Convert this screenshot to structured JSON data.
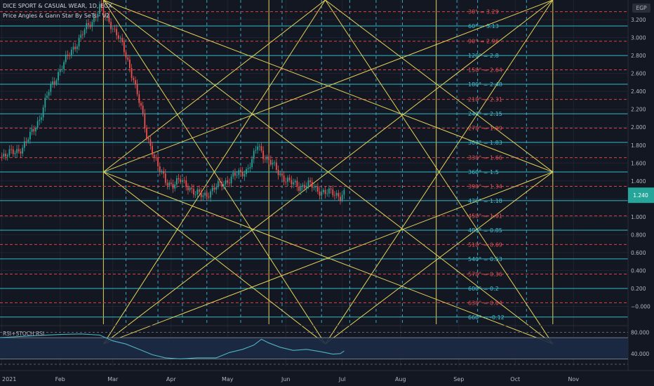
{
  "header": {
    "symbol": "DICE SPORT & CASUAL WEAR, 1D, EGX",
    "indicator": "Price Angles & Gann Star By SeTs - V2",
    "currency": "EGP"
  },
  "colors": {
    "background": "#131722",
    "up_candle": "#26a69a",
    "down_candle": "#ef5350",
    "gann_star": "#e6d15a",
    "price_level_cyan": "#33b8c8",
    "price_level_red": "#d84343",
    "time_line": "#3aa3c9",
    "last_price": "#26a69a",
    "rsi_line": "#4eb3c2"
  },
  "chart_data": [
    {
      "type": "candlestick",
      "title": "DICE SPORT & CASUAL WEAR, 1D, EGX",
      "y_axis": {
        "unit": "EGP",
        "range": [
          -0.2,
          3.42
        ],
        "ticks": [
          "3.200",
          "3.000",
          "2.800",
          "2.600",
          "2.400",
          "2.200",
          "2.000",
          "1.800",
          "1.600",
          "1.400",
          "1.200",
          "1.000",
          "0.800",
          "0.600",
          "0.400",
          "0.200",
          "−0.000"
        ]
      },
      "x_axis": {
        "range": [
          "2020-12-31",
          "2021-11-30"
        ],
        "tick_labels": [
          {
            "label": "2021",
            "date": "2021-01-01"
          },
          {
            "label": "Feb",
            "date": "2021-02-01"
          },
          {
            "label": "Mar",
            "date": "2021-03-01"
          },
          {
            "label": "Apr",
            "date": "2021-04-01"
          },
          {
            "label": "May",
            "date": "2021-05-01"
          },
          {
            "label": "Jun",
            "date": "2021-06-01"
          },
          {
            "label": "Jul",
            "date": "2021-07-01"
          },
          {
            "label": "Aug",
            "date": "2021-08-01"
          },
          {
            "label": "Sep",
            "date": "2021-09-01"
          },
          {
            "label": "Oct",
            "date": "2021-10-01"
          },
          {
            "label": "Nov",
            "date": "2021-11-01"
          }
        ]
      },
      "last_price": 1.24,
      "price_path": [
        [
          "2020-12-31",
          1.68
        ],
        [
          "2021-01-08",
          1.72
        ],
        [
          "2021-01-12",
          1.78
        ],
        [
          "2021-01-16",
          1.9
        ],
        [
          "2021-01-21",
          2.1
        ],
        [
          "2021-01-26",
          2.4
        ],
        [
          "2021-02-01",
          2.65
        ],
        [
          "2021-02-07",
          2.85
        ],
        [
          "2021-02-13",
          3.05
        ],
        [
          "2021-02-18",
          3.18
        ],
        [
          "2021-02-22",
          3.35
        ],
        [
          "2021-02-25",
          3.22
        ],
        [
          "2021-03-01",
          3.12
        ],
        [
          "2021-03-04",
          3.02
        ],
        [
          "2021-03-08",
          2.78
        ],
        [
          "2021-03-12",
          2.55
        ],
        [
          "2021-03-16",
          2.2
        ],
        [
          "2021-03-19",
          1.9
        ],
        [
          "2021-03-22",
          1.75
        ],
        [
          "2021-03-25",
          1.55
        ],
        [
          "2021-03-29",
          1.4
        ],
        [
          "2021-04-02",
          1.36
        ],
        [
          "2021-04-06",
          1.4
        ],
        [
          "2021-04-10",
          1.35
        ],
        [
          "2021-04-14",
          1.25
        ],
        [
          "2021-04-18",
          1.24
        ],
        [
          "2021-04-22",
          1.28
        ],
        [
          "2021-04-27",
          1.36
        ],
        [
          "2021-05-02",
          1.42
        ],
        [
          "2021-05-07",
          1.48
        ],
        [
          "2021-05-11",
          1.52
        ],
        [
          "2021-05-14",
          1.62
        ],
        [
          "2021-05-17",
          1.8
        ],
        [
          "2021-05-20",
          1.7
        ],
        [
          "2021-05-24",
          1.6
        ],
        [
          "2021-05-28",
          1.5
        ],
        [
          "2021-06-03",
          1.38
        ],
        [
          "2021-06-08",
          1.34
        ],
        [
          "2021-06-13",
          1.36
        ],
        [
          "2021-06-17",
          1.31
        ],
        [
          "2021-06-22",
          1.27
        ],
        [
          "2021-06-26",
          1.26
        ],
        [
          "2021-06-30",
          1.24
        ],
        [
          "2021-07-02",
          1.26
        ]
      ],
      "price_levels": [
        {
          "label": "30° = 3.29",
          "value": 3.29,
          "color": "red"
        },
        {
          "label": "60° = 3.13",
          "value": 3.13,
          "color": "cyan"
        },
        {
          "label": "90° = 2.96",
          "value": 2.96,
          "color": "red"
        },
        {
          "label": "120° = 2.8",
          "value": 2.8,
          "color": "cyan"
        },
        {
          "label": "150° = 2.64",
          "value": 2.64,
          "color": "red"
        },
        {
          "label": "180° = 2.48",
          "value": 2.48,
          "color": "cyan"
        },
        {
          "label": "210° = 2.31",
          "value": 2.31,
          "color": "red"
        },
        {
          "label": "240° = 2.15",
          "value": 2.15,
          "color": "cyan"
        },
        {
          "label": "270° = 1.99",
          "value": 1.99,
          "color": "red"
        },
        {
          "label": "300° = 1.83",
          "value": 1.83,
          "color": "cyan"
        },
        {
          "label": "330° = 1.66",
          "value": 1.66,
          "color": "red"
        },
        {
          "label": "360° = 1.5",
          "value": 1.5,
          "color": "cyan"
        },
        {
          "label": "390° = 1.34",
          "value": 1.34,
          "color": "red"
        },
        {
          "label": "420° = 1.18",
          "value": 1.18,
          "color": "cyan"
        },
        {
          "label": "450° = 1.01",
          "value": 1.01,
          "color": "red"
        },
        {
          "label": "480° = 0.85",
          "value": 0.85,
          "color": "cyan"
        },
        {
          "label": "510° = 0.69",
          "value": 0.69,
          "color": "red"
        },
        {
          "label": "540° = 0.53",
          "value": 0.53,
          "color": "cyan"
        },
        {
          "label": "570° = 0.36",
          "value": 0.36,
          "color": "red"
        },
        {
          "label": "600° = 0.2",
          "value": 0.2,
          "color": "cyan"
        },
        {
          "label": "630° = 0.04",
          "value": 0.04,
          "color": "red"
        },
        {
          "label": "660° = -0.12",
          "value": -0.12,
          "color": "cyan"
        }
      ],
      "time_lines_solid": [
        "2021-02-24",
        "2021-05-23",
        "2021-08-20",
        "2021-10-21"
      ],
      "time_lines_dashed": [
        "2021-03-08",
        "2021-03-25",
        "2021-04-07",
        "2021-04-20",
        "2021-05-08",
        "2021-05-30",
        "2021-06-20",
        "2021-07-05",
        "2021-07-19",
        "2021-08-02",
        "2021-08-31",
        "2021-09-11",
        "2021-10-07"
      ],
      "gann_star": {
        "points": {
          "L": [
            "2021-02-24",
            1.5
          ],
          "R": [
            "2021-10-21",
            1.5
          ],
          "TL": [
            "2021-02-24",
            3.42
          ],
          "TR": [
            "2021-10-21",
            3.42
          ],
          "TM": [
            "2021-06-22",
            3.42
          ],
          "BM": [
            "2021-06-22",
            -0.42
          ],
          "BL": [
            "2021-02-24",
            -0.42
          ],
          "BR": [
            "2021-10-21",
            -0.42
          ]
        },
        "segments": [
          [
            "L",
            "TM"
          ],
          [
            "L",
            "BM"
          ],
          [
            "R",
            "TM"
          ],
          [
            "R",
            "BM"
          ],
          [
            "L",
            "TR"
          ],
          [
            "L",
            "BR"
          ],
          [
            "R",
            "TL"
          ],
          [
            "R",
            "BL"
          ],
          [
            "TL",
            "BR"
          ],
          [
            "TR",
            "BL"
          ],
          [
            "TL",
            "BM"
          ],
          [
            "TR",
            "BM"
          ],
          [
            "BL",
            "TM"
          ],
          [
            "BR",
            "TM"
          ]
        ]
      }
    },
    {
      "type": "line",
      "title": "RSI+STOCH RSI",
      "y_axis": {
        "range": [
          16,
          90
        ],
        "ticks": [
          "80.000",
          "40.000"
        ]
      },
      "band": [
        30,
        70
      ],
      "guides": [
        80,
        20
      ],
      "series": [
        {
          "values": [
            [
              "2020-12-31",
              70
            ],
            [
              "2021-01-10",
              72
            ],
            [
              "2021-01-20",
              74
            ],
            [
              "2021-02-01",
              76
            ],
            [
              "2021-02-12",
              77
            ],
            [
              "2021-02-22",
              75
            ],
            [
              "2021-03-01",
              64
            ],
            [
              "2021-03-08",
              58
            ],
            [
              "2021-03-15",
              48
            ],
            [
              "2021-03-22",
              38
            ],
            [
              "2021-03-29",
              32
            ],
            [
              "2021-04-06",
              30
            ],
            [
              "2021-04-15",
              32
            ],
            [
              "2021-04-25",
              32
            ],
            [
              "2021-05-02",
              42
            ],
            [
              "2021-05-09",
              48
            ],
            [
              "2021-05-15",
              56
            ],
            [
              "2021-05-19",
              67
            ],
            [
              "2021-05-23",
              60
            ],
            [
              "2021-05-29",
              52
            ],
            [
              "2021-06-05",
              46
            ],
            [
              "2021-06-12",
              48
            ],
            [
              "2021-06-19",
              44
            ],
            [
              "2021-06-26",
              39
            ],
            [
              "2021-06-30",
              40
            ],
            [
              "2021-07-02",
              45
            ]
          ]
        }
      ]
    }
  ]
}
